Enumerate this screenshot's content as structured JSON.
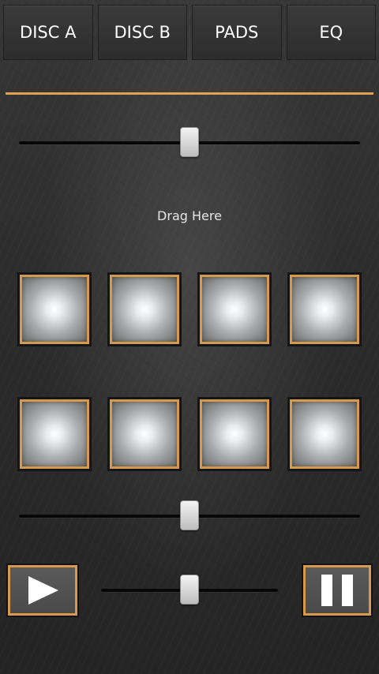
{
  "tabs": [
    {
      "label": "DISC A"
    },
    {
      "label": "DISC B"
    },
    {
      "label": "PADS"
    },
    {
      "label": "EQ"
    }
  ],
  "main": {
    "drag_label": "Drag Here",
    "top_slider": {
      "value": 0.5
    },
    "pads": {
      "rows": 2,
      "columns": 4
    },
    "bottom_slider": {
      "value": 0.5
    },
    "transport_slider": {
      "value": 0.5
    }
  },
  "transport": {
    "play_icon": "play-icon",
    "pause_icon": "pause-icon"
  },
  "colors": {
    "accent": "#e0a24f",
    "tab_text": "#ffffff",
    "pad_border": "#d59a4d"
  }
}
